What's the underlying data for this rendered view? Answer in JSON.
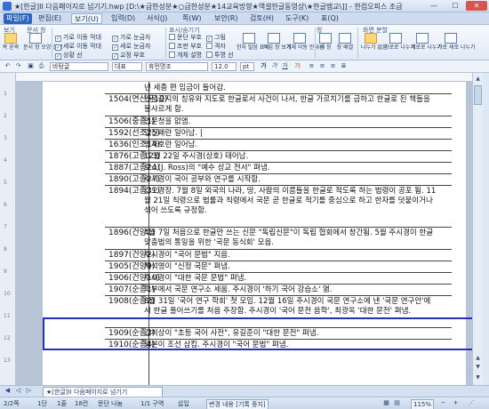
{
  "window": {
    "title": "★[한글]II 다음페이지로 넘기기.hwp [D:\\★급한성분★○급한성분★14교육방향★액셀한글동영상\\★한글맵교\\]] - 한컴오피스 조급",
    "minimize": "—",
    "maximize": "☐",
    "close": "✕"
  },
  "menu": [
    {
      "label": "파일(F)"
    },
    {
      "label": "편집(E)"
    },
    {
      "label": "보기(U)"
    },
    {
      "label": "입력(D)"
    },
    {
      "label": "서식(J)"
    },
    {
      "label": "쪽(W)"
    },
    {
      "label": "보안(R)"
    },
    {
      "label": "검토(H)"
    },
    {
      "label": "도구(K)"
    },
    {
      "label": "표(Q)"
    }
  ],
  "ribbon": {
    "groups": {
      "view": "보기",
      "doc_mode": "문서 창",
      "display": "표시/숨기기",
      "window": "창",
      "split": "화면 분할"
    },
    "big_buttons": {
      "fit": "쪽 윤곽",
      "doc_window": "문서 창 모양 설정",
      "all_view": "한자 발음 표시",
      "align": "작업 창 보기",
      "unit": "개체 이동 안내선",
      "new_window": "새 창",
      "arrange": "창 배열",
      "tile": "창 나누기",
      "split_none": "나누기 없음",
      "split_h": "가로로 나누기",
      "split_v": "세로로 나누기",
      "split_hv": "가로 세로 나누기"
    },
    "checks": [
      {
        "label": "가로 이동 막대",
        "checked": true
      },
      {
        "label": "세로 이동 막대",
        "checked": true
      },
      {
        "label": "상황 선",
        "checked": true
      },
      {
        "label": "가로 눈금자",
        "checked": true
      },
      {
        "label": "세로 눈금자",
        "checked": true
      },
      {
        "label": "교정 부호",
        "checked": true
      },
      {
        "label": "문단 부호",
        "checked": false
      },
      {
        "label": "조판 부호",
        "checked": false
      },
      {
        "label": "개체 설명",
        "checked": false
      },
      {
        "label": "그림",
        "checked": true
      },
      {
        "label": "격자",
        "checked": false
      },
      {
        "label": "투명 선",
        "checked": false
      }
    ]
  },
  "toolbar2": {
    "style": "바탕글",
    "font_lang": "대표",
    "font": "휴먼명조",
    "size": "12.0",
    "unit": "pt"
  },
  "ruler_marks": [
    "1",
    "2",
    "3",
    "4",
    "5",
    "6",
    "7",
    "8",
    "9",
    "10",
    "11",
    "12",
    "13"
  ],
  "table_rows": [
    {
      "year": "",
      "text": "년 세종 편 임금이 들어감."
    },
    {
      "year": "1504(연산군10)",
      "text": "언문금지의 칭유와 지도로 한글로서 사건이 나서, 한글 가르치기를 금하고 한글로 된 책들을 불사르게 함."
    },
    {
      "year": "1506(중종1)",
      "text": "언문청을 없앰."
    },
    {
      "year": "1592(선조25)",
      "text": "임진왜란 일어남. |"
    },
    {
      "year": "1636(인조14)",
      "text": "병자호란 일어남."
    },
    {
      "year": "1876(고종13)",
      "text": "12월 22일 주시경(상호) 태어남."
    },
    {
      "year": "1887(고종24)",
      "text": "로스(J. Ross)의 \"예수 성교 전서\" 펴냄."
    },
    {
      "year": "1890(고종27)",
      "text": "주시경이 국어 공부와 연구를 시작함."
    },
    {
      "year": "1894(고종31)",
      "text": "갑오경장. 7월 8일 외국의 나라, 땅, 사람의 이름들을 한글로 적도록 하는 법령이 공포 됨. 11월 21일 칙령으로 법률과 칙령에서 국문 곧 한글로 적기를 중심으로 하고 한자를 덧붙이거나 섞어 쓰도록 규정함."
    },
    {
      "year": "1896(건양1)",
      "text": "4월 7일 처음으로 한글만 쓰는 신문 \"독립신문\"이 독립 협회에서 창간됨. 5월 주시경이 한글맞춤법의 통일을 위한 '국문 동식회' 모음."
    },
    {
      "year": "1897(건양2)",
      "text": "주시경이 \"국어 문법\" 지음."
    },
    {
      "year": "1905(건양9)",
      "text": "지석영이 \"신정 국문\" 펴냄."
    },
    {
      "year": "1906(건양10)",
      "text": "주시경이 \"대한 국문 문법\" 펴냄."
    },
    {
      "year": "1907(순종1)",
      "text": "학부에서 국문 연구소 세움. 주시경이 '하기 국어 강습소' 엶."
    },
    {
      "year": "1908(순종2)",
      "text": "8월 31일 '국어 연구 학회' 첫 모임. 12월 16일 주시경이 국문 연구소에 낸 '국문 연구안'에서 한글 풀어쓰기를 처음 주장함. 주시경이 '국어 문전 음학', 최광옥 '대한 문전' 펴냄."
    },
    {
      "year": "1909(순종3)",
      "text": "김희상이 \"초등 국어 사전\", 유길준이 \"대한 문전\" 펴냄."
    },
    {
      "year": "1910(순종4)",
      "text": "일본이 조선 삼킴. 주시경이 \"국어 문법\" 펴냄."
    }
  ],
  "doc_tab": {
    "label": "★[한글]II 다음페이지로 넘기기"
  },
  "status": {
    "page": "2/2쪽",
    "section": "1단",
    "line": "1줄",
    "col": "18칸",
    "para": "문단 나눔",
    "sec": "1/1 구역",
    "mode": "삽입",
    "track": "변경 내용 [기록 중지]",
    "zoom": "115%"
  }
}
